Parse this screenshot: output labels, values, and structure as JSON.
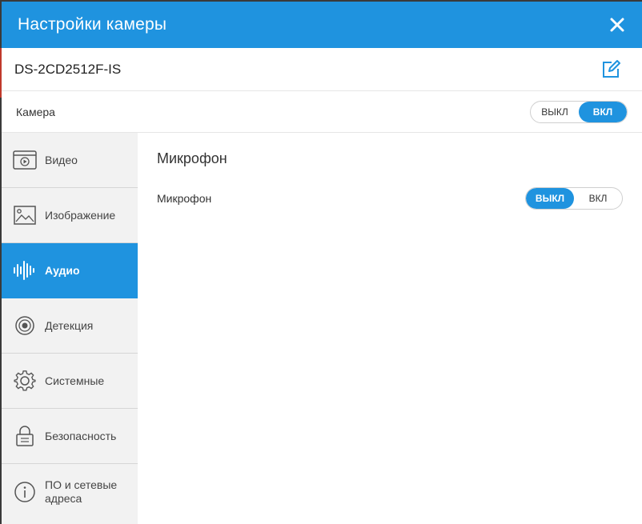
{
  "dialog": {
    "title": "Настройки камеры",
    "close_icon": "close-icon"
  },
  "device": {
    "name": "DS-2CD2512F-IS",
    "edit_icon": "edit-icon"
  },
  "camera": {
    "label": "Камера",
    "toggle_off": "ВЫКЛ",
    "toggle_on": "ВКЛ",
    "state": "on"
  },
  "sidebar": {
    "items": [
      {
        "label": "Видео",
        "icon": "video-icon"
      },
      {
        "label": "Изображение",
        "icon": "image-icon"
      },
      {
        "label": "Аудио",
        "icon": "audio-wave-icon",
        "active": true
      },
      {
        "label": "Детекция",
        "icon": "detection-icon"
      },
      {
        "label": "Системные",
        "icon": "gear-icon"
      },
      {
        "label": "Безопасность",
        "icon": "lock-icon"
      },
      {
        "label": "ПО и сетевые\nадреса",
        "icon": "info-icon"
      }
    ]
  },
  "main": {
    "section_title": "Микрофон",
    "microphone": {
      "label": "Микрофон",
      "toggle_off": "ВЫКЛ",
      "toggle_on": "ВКЛ",
      "state": "off"
    }
  },
  "colors": {
    "accent": "#1f93df",
    "sidebar_bg": "#f2f2f2"
  }
}
